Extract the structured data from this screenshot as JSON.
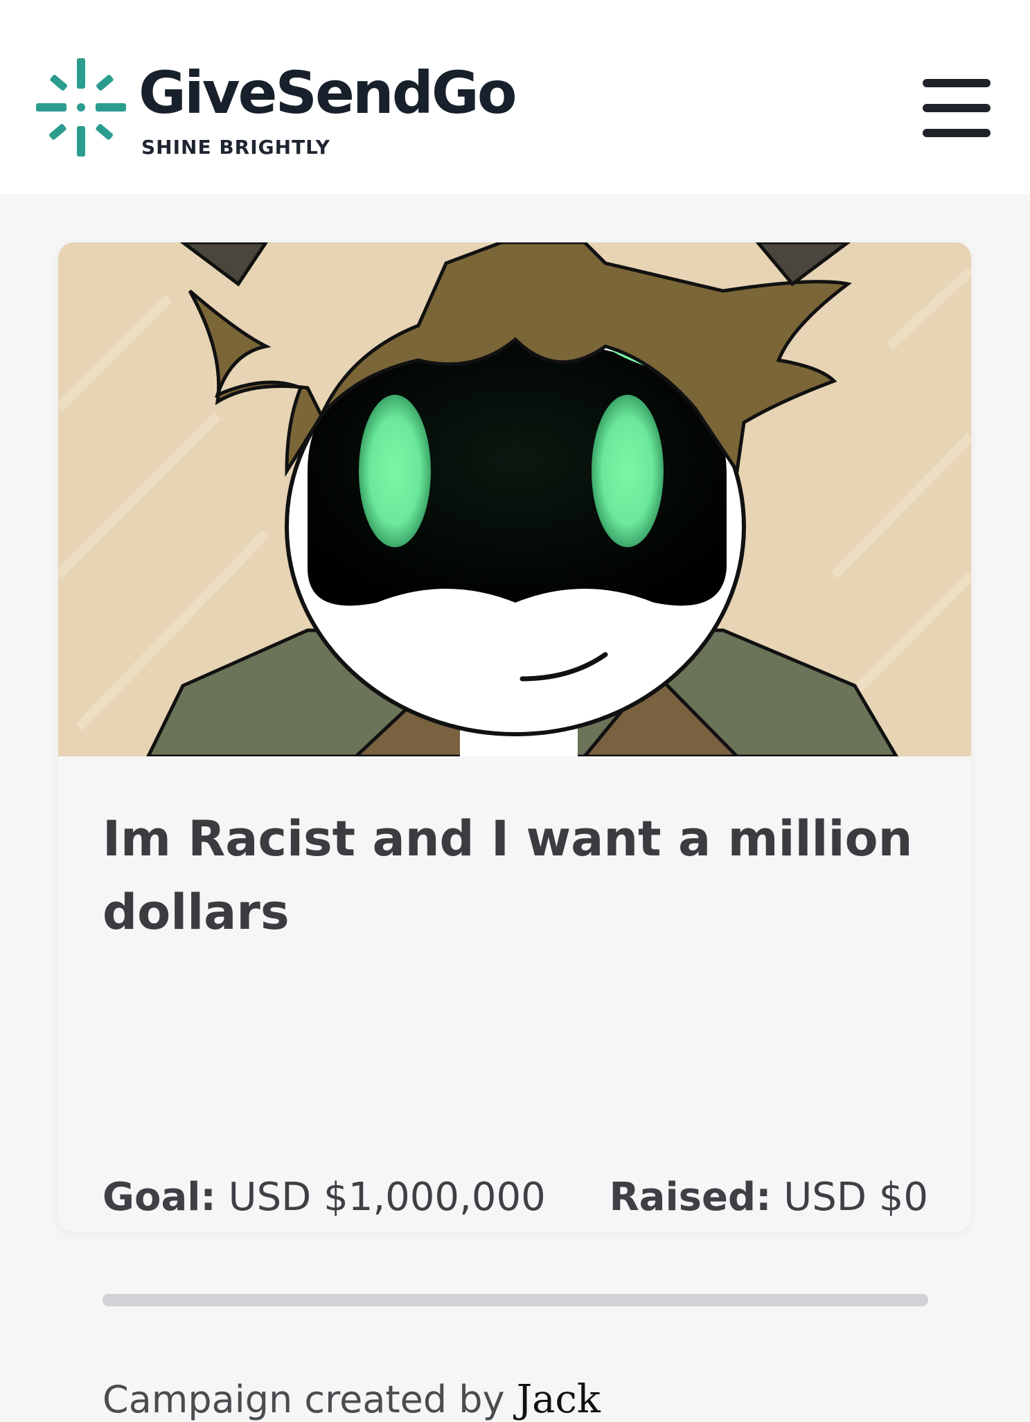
{
  "brand": {
    "name": "GiveSendGo",
    "tagline": "SHINE BRIGHTLY",
    "logo_icon": "sparkle-burst-icon",
    "color": "#2a9d8f"
  },
  "header": {
    "menu_icon": "hamburger-menu-icon"
  },
  "campaign": {
    "image": "cartoon-robot-character-illustration",
    "title": "Im Racist and I want a million dollars",
    "goal_label": "Goal:",
    "goal_value": "USD $1,000,000",
    "raised_label": "Raised:",
    "raised_value": "USD $0",
    "progress_fraction": 0,
    "created_by_prefix": "Campaign created by",
    "creator_name": "Jack"
  }
}
